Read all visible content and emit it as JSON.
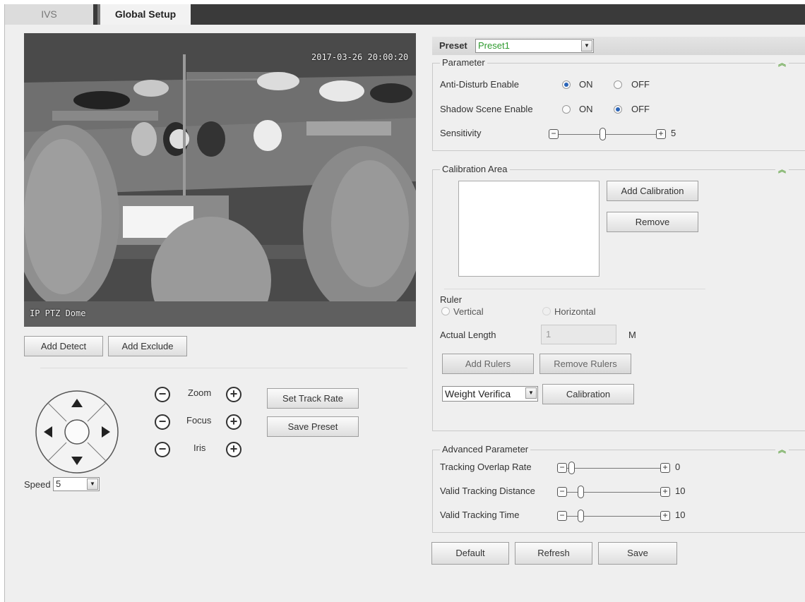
{
  "tabs": [
    {
      "label": "IVS",
      "active": false
    },
    {
      "label": "Global Setup",
      "active": true
    }
  ],
  "video": {
    "timestamp": "2017-03-26 20:00:20",
    "camera_name": "IP PTZ Dome"
  },
  "video_buttons": {
    "add_detect": "Add Detect",
    "add_exclude": "Add Exclude"
  },
  "ptz": {
    "zoom_label": "Zoom",
    "focus_label": "Focus",
    "iris_label": "Iris",
    "set_track_rate": "Set Track Rate",
    "save_preset": "Save Preset",
    "speed_label": "Speed",
    "speed_value": "5"
  },
  "preset": {
    "label": "Preset",
    "value": "Preset1"
  },
  "parameter": {
    "title": "Parameter",
    "anti_disturb_label": "Anti-Disturb Enable",
    "anti_disturb_value": "ON",
    "shadow_scene_label": "Shadow Scene Enable",
    "shadow_scene_value": "OFF",
    "on_label": "ON",
    "off_label": "OFF",
    "sensitivity_label": "Sensitivity",
    "sensitivity_value": "5",
    "sensitivity_level": 0.45
  },
  "calibration": {
    "title": "Calibration Area",
    "add_calibration": "Add Calibration",
    "remove": "Remove",
    "ruler_label": "Ruler",
    "vertical_label": "Vertical",
    "horizontal_label": "Horizontal",
    "actual_length_label": "Actual Length",
    "actual_length_value": "1",
    "unit": "M",
    "add_rulers": "Add Rulers",
    "remove_rulers": "Remove Rulers",
    "verify_select": "Weight Verifica",
    "calibration_button": "Calibration"
  },
  "advanced": {
    "title": "Advanced Parameter",
    "tracking_overlap_label": "Tracking Overlap Rate",
    "tracking_overlap_value": "0",
    "valid_distance_label": "Valid Tracking Distance",
    "valid_distance_value": "10",
    "valid_time_label": "Valid Tracking Time",
    "valid_time_value": "10"
  },
  "footer": {
    "default": "Default",
    "refresh": "Refresh",
    "save": "Save"
  },
  "colors": {
    "tabbar": "#3a3a3a",
    "preset_value": "#2e9a2e",
    "collapse_icon": "#6aa84f",
    "radio_selected": "#2a64b8"
  }
}
